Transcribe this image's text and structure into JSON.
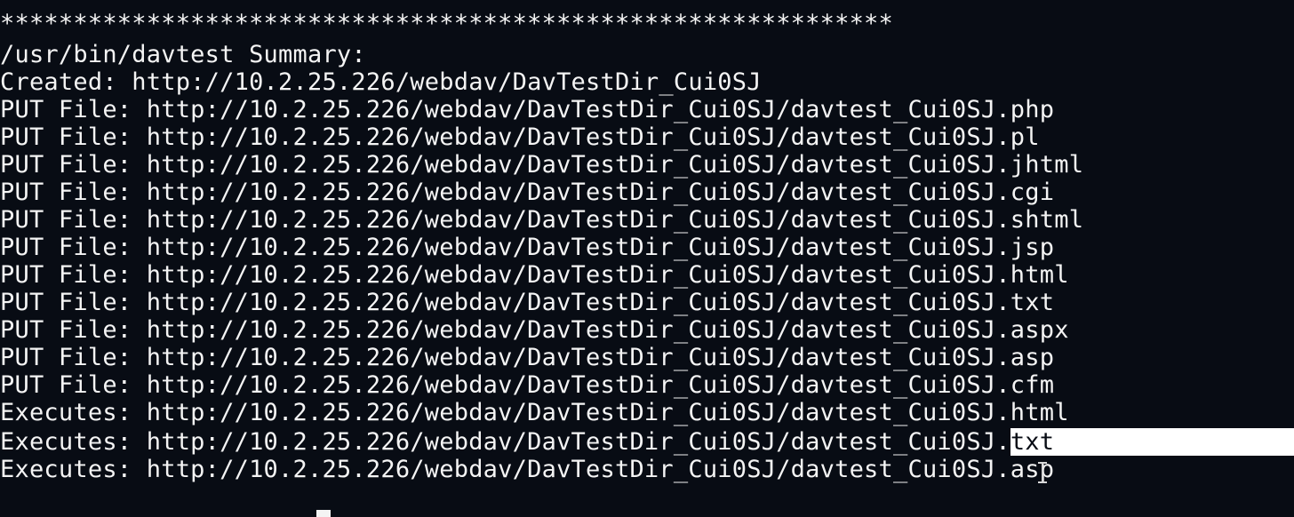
{
  "terminal": {
    "lines": [
      "*************************************************************",
      "/usr/bin/davtest Summary:",
      "Created: http://10.2.25.226/webdav/DavTestDir_Cui0SJ",
      "PUT File: http://10.2.25.226/webdav/DavTestDir_Cui0SJ/davtest_Cui0SJ.php",
      "PUT File: http://10.2.25.226/webdav/DavTestDir_Cui0SJ/davtest_Cui0SJ.pl",
      "PUT File: http://10.2.25.226/webdav/DavTestDir_Cui0SJ/davtest_Cui0SJ.jhtml",
      "PUT File: http://10.2.25.226/webdav/DavTestDir_Cui0SJ/davtest_Cui0SJ.cgi",
      "PUT File: http://10.2.25.226/webdav/DavTestDir_Cui0SJ/davtest_Cui0SJ.shtml",
      "PUT File: http://10.2.25.226/webdav/DavTestDir_Cui0SJ/davtest_Cui0SJ.jsp",
      "PUT File: http://10.2.25.226/webdav/DavTestDir_Cui0SJ/davtest_Cui0SJ.html",
      "PUT File: http://10.2.25.226/webdav/DavTestDir_Cui0SJ/davtest_Cui0SJ.txt",
      "PUT File: http://10.2.25.226/webdav/DavTestDir_Cui0SJ/davtest_Cui0SJ.aspx",
      "PUT File: http://10.2.25.226/webdav/DavTestDir_Cui0SJ/davtest_Cui0SJ.asp",
      "PUT File: http://10.2.25.226/webdav/DavTestDir_Cui0SJ/davtest_Cui0SJ.cfm",
      "Executes: http://10.2.25.226/webdav/DavTestDir_Cui0SJ/davtest_Cui0SJ.html"
    ],
    "selected_line": {
      "prefix": "Executes: http://10.2.25.226/webdav/DavTestDir_Cui0SJ/davtest_Cui0SJ.",
      "selected_text": "txt"
    },
    "last_line": "Executes: http://10.2.25.226/webdav/DavTestDir_Cui0SJ/davtest_Cui0SJ.asp",
    "cursor_icon": "text-ibeam-cursor-icon",
    "colors": {
      "background": "#080c14",
      "foreground": "#f4f4f4",
      "selection": "#ffffff"
    }
  }
}
